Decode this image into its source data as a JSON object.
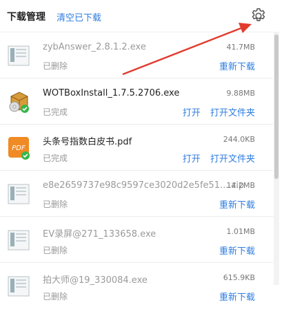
{
  "header": {
    "title": "下载管理",
    "clear_label": "清空已下载",
    "settings_icon": "gear-icon"
  },
  "items": [
    {
      "filename": "zybAnswer_2.8.1.2.exe",
      "size": "41.7MB",
      "status": "已删除",
      "actions": [
        "重新下载"
      ],
      "icon": "exe-file-icon"
    },
    {
      "filename": "WOTBoxInstall_1.7.5.2706.exe",
      "size": "9.88MB",
      "status": "已完成",
      "actions": [
        "打开",
        "打开文件夹"
      ],
      "icon": "installer-box-icon"
    },
    {
      "filename": "头条号指数白皮书.pdf",
      "size": "244.0KB",
      "status": "已完成",
      "actions": [
        "打开",
        "打开文件夹"
      ],
      "icon": "pdf-file-icon"
    },
    {
      "filename": "e8e2659737e98c9597ce3020d2e5fe51....zip",
      "size": "14.2MB",
      "status": "已删除",
      "actions": [
        "重新下载"
      ],
      "icon": "zip-file-icon"
    },
    {
      "filename": "EV录屏@271_133658.exe",
      "size": "1.01MB",
      "status": "已删除",
      "actions": [
        "重新下载"
      ],
      "icon": "exe-file-icon"
    },
    {
      "filename": "拍大师@19_330084.exe",
      "size": "615.9KB",
      "status": "已删除",
      "actions": [
        "重新下载"
      ],
      "icon": "exe-file-icon"
    }
  ],
  "colors": {
    "link": "#2f7de1",
    "annotation_arrow": "#e23b2e",
    "pdf_orange": "#f08a24",
    "check_green": "#3ab54a"
  }
}
